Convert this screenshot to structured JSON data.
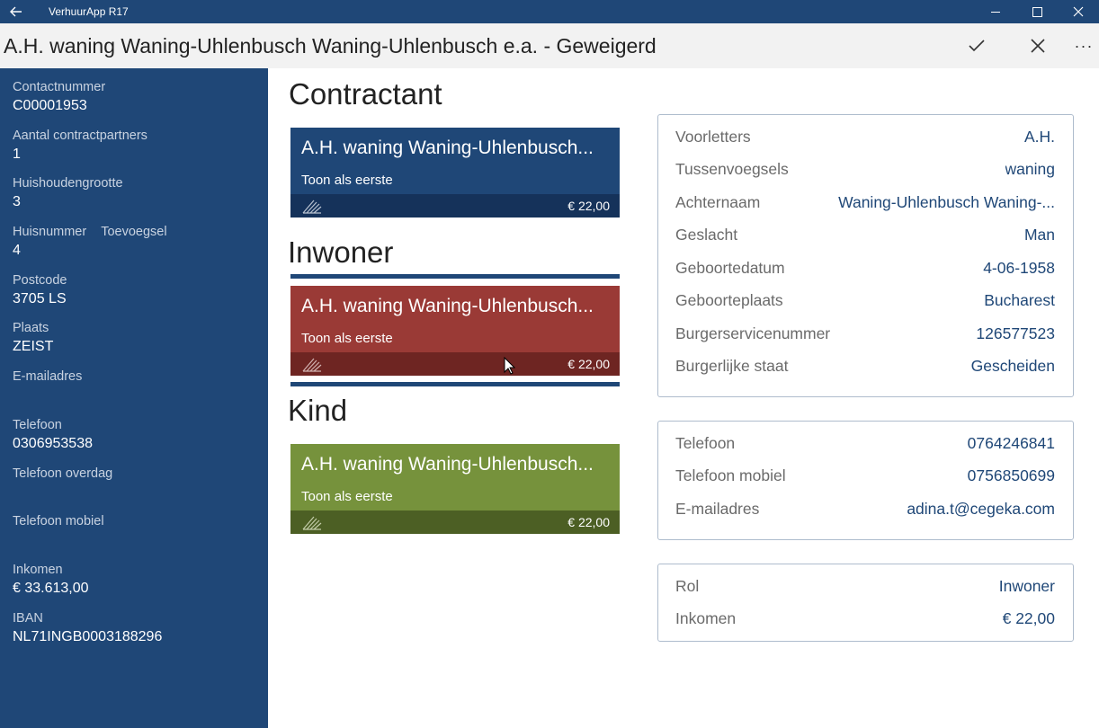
{
  "window": {
    "app_title": "VerhuurApp R17",
    "back_icon": "back-arrow-icon",
    "minimize_icon": "minimize-icon",
    "maximize_icon": "maximize-icon",
    "close_icon": "close-icon"
  },
  "header": {
    "title": "A.H. waning Waning-Uhlenbusch Waning-Uhlenbusch e.a. - Geweigerd",
    "accept_icon": "checkmark-icon",
    "cancel_icon": "close-icon",
    "more_icon": "more-icon",
    "more_label": "···"
  },
  "sidebar": {
    "contactnummer_label": "Contactnummer",
    "contactnummer_value": "C00001953",
    "contractpartners_label": "Aantal contractpartners",
    "contractpartners_value": "1",
    "huishouden_label": "Huishoudengrootte",
    "huishouden_value": "3",
    "huisnummer_label": "Huisnummer",
    "toevoegsel_label": "Toevoegsel",
    "huisnummer_value": "4",
    "postcode_label": "Postcode",
    "postcode_value": "3705 LS",
    "plaats_label": "Plaats",
    "plaats_value": "ZEIST",
    "email_label": "E-mailadres",
    "email_value": "",
    "telefoon_label": "Telefoon",
    "telefoon_value": "0306953538",
    "telefoon_overdag_label": "Telefoon overdag",
    "telefoon_overdag_value": "",
    "telefoon_mobiel_label": "Telefoon mobiel",
    "telefoon_mobiel_value": "",
    "inkomen_label": "Inkomen",
    "inkomen_value": "€ 33.613,00",
    "iban_label": "IBAN",
    "iban_value": "NL71INGB0003188296"
  },
  "sections": {
    "contractant": "Contractant",
    "inwoner": "Inwoner",
    "kind": "Kind"
  },
  "cards": [
    {
      "name": "A.H. waning Waning-Uhlenbusch...",
      "action": "Toon als eerste",
      "amount": "€ 22,00",
      "color": "#1f4777"
    },
    {
      "name": "A.H. waning Waning-Uhlenbusch...",
      "action": "Toon als eerste",
      "amount": "€ 22,00",
      "color": "#9a3a36"
    },
    {
      "name": "A.H. waning Waning-Uhlenbusch...",
      "action": "Toon als eerste",
      "amount": "€ 22,00",
      "color": "#76923c"
    }
  ],
  "personal": {
    "voorletters_label": "Voorletters",
    "voorletters_value": "A.H.",
    "tussenvoegsels_label": "Tussenvoegsels",
    "tussenvoegsels_value": "waning",
    "achternaam_label": "Achternaam",
    "achternaam_value": "Waning-Uhlenbusch Waning-...",
    "geslacht_label": "Geslacht",
    "geslacht_value": "Man",
    "geboortedatum_label": "Geboortedatum",
    "geboortedatum_value": "4-06-1958",
    "geboorteplaats_label": "Geboorteplaats",
    "geboorteplaats_value": "Bucharest",
    "bsn_label": "Burgerservicenummer",
    "bsn_value": "126577523",
    "staat_label": "Burgerlijke staat",
    "staat_value": "Gescheiden"
  },
  "contact": {
    "telefoon_label": "Telefoon",
    "telefoon_value": "0764246841",
    "mobiel_label": "Telefoon mobiel",
    "mobiel_value": "0756850699",
    "email_label": "E-mailadres",
    "email_value": "adina.t@cegeka.com"
  },
  "role": {
    "rol_label": "Rol",
    "rol_value": "Inwoner",
    "inkomen_label": "Inkomen",
    "inkomen_value": "€ 22,00"
  }
}
